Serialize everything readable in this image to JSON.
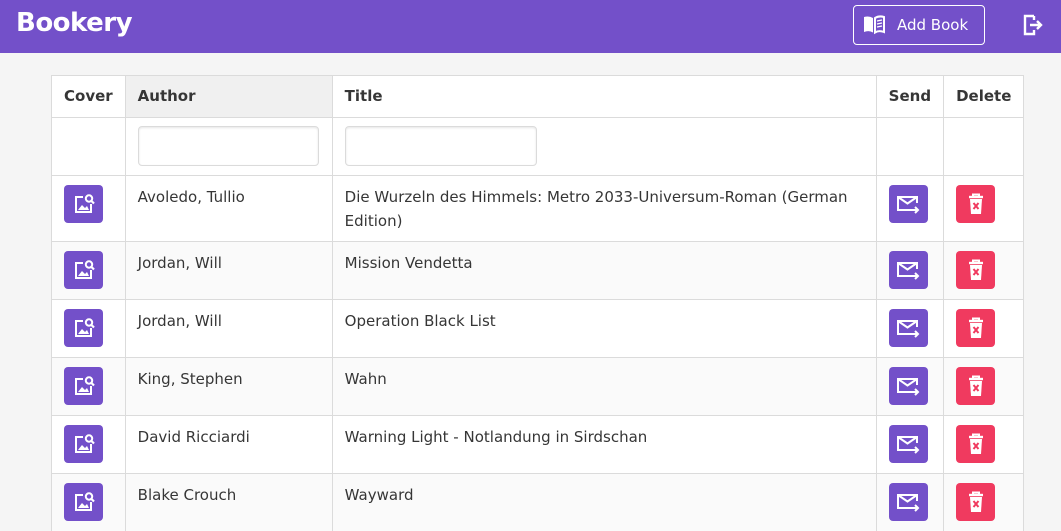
{
  "app": {
    "title": "Bookery"
  },
  "toolbar": {
    "add_book_label": "Add Book"
  },
  "table": {
    "headers": {
      "cover": "Cover",
      "author": "Author",
      "title": "Title",
      "send": "Send",
      "delete": "Delete"
    },
    "sorted_column": "author",
    "filters": {
      "author": "",
      "title": ""
    },
    "rows": [
      {
        "author": "Avoledo, Tullio",
        "title": "Die Wurzeln des Himmels: Metro 2033-Universum-Roman (German Edition)"
      },
      {
        "author": "Jordan, Will",
        "title": "Mission Vendetta"
      },
      {
        "author": "Jordan, Will",
        "title": "Operation Black List"
      },
      {
        "author": "King, Stephen",
        "title": "Wahn"
      },
      {
        "author": "David Ricciardi",
        "title": "Warning Light - Notlandung in Sirdschan"
      },
      {
        "author": "Blake Crouch",
        "title": "Wayward"
      }
    ]
  },
  "icons": {
    "add_book": "book-open-icon",
    "logout": "logout-icon",
    "cover": "image-search-icon",
    "send": "email-send-icon",
    "delete": "trash-icon"
  },
  "colors": {
    "primary": "#7350c9",
    "danger": "#f03a5f",
    "background": "#f5f5f5"
  }
}
